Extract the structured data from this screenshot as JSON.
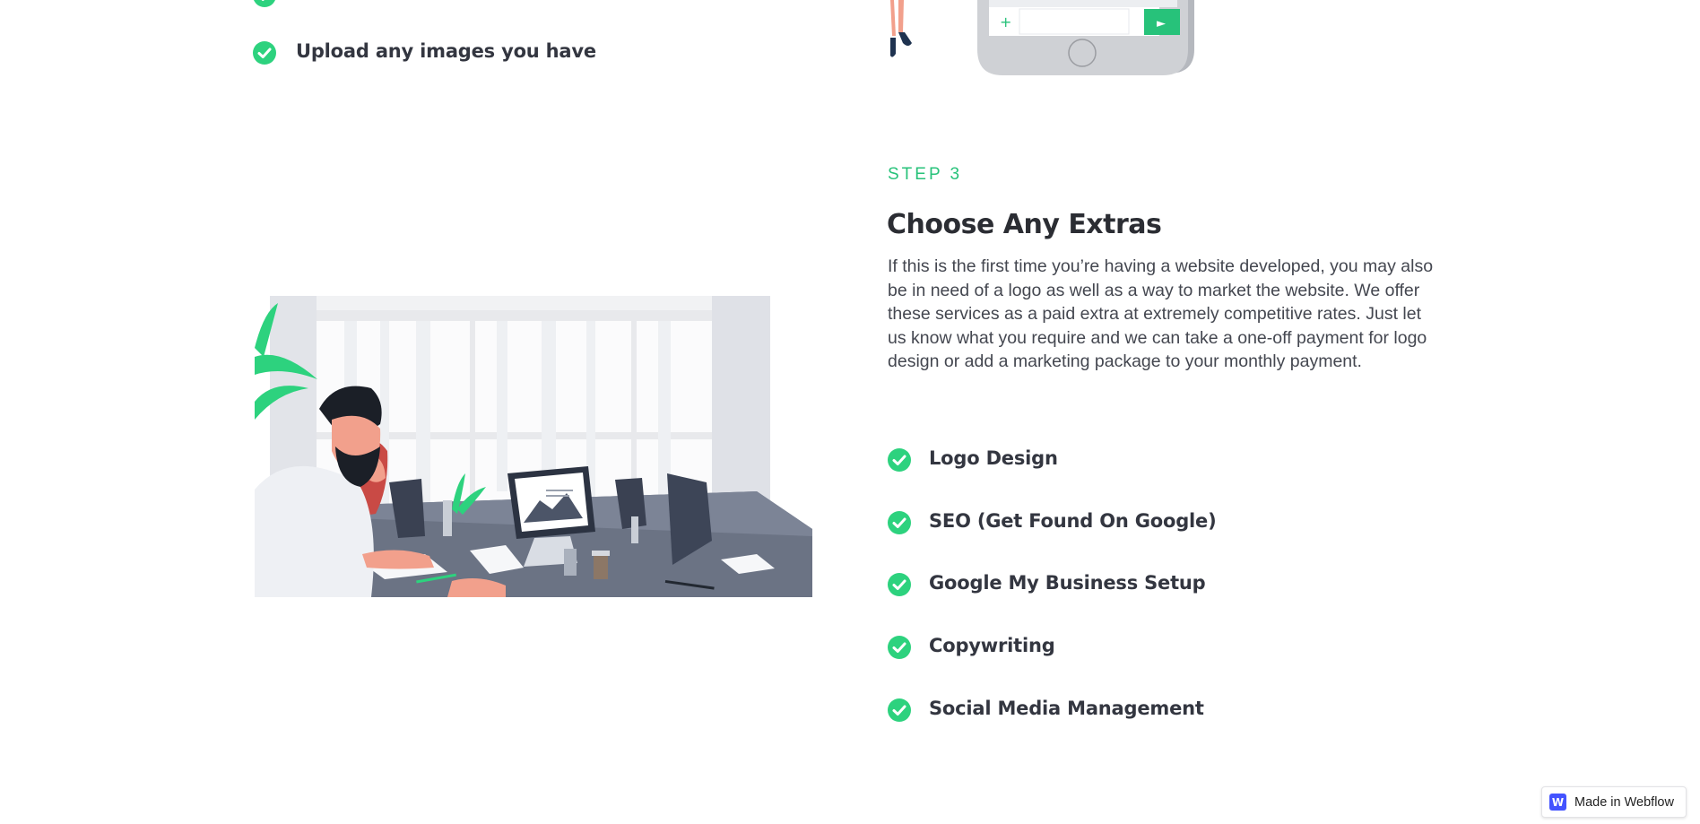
{
  "previous_step": {
    "upload_item": "Upload any images you have"
  },
  "phone_chat": {
    "plus_glyph": "+",
    "send_glyph": "►"
  },
  "step3": {
    "label": "STEP 3",
    "title": "Choose Any Extras",
    "description": "If this is the first time you’re having a website developed, you may also be in need of a logo as well as a way to market the website. We offer these services as a paid extra at extremely competitive rates. Just let us know what you require and we can take a one-off payment for logo design or add a marketing package to your monthly payment.",
    "extras": [
      "Logo Design",
      "SEO (Get Found On Google)",
      "Google My Business Setup",
      "Copywriting",
      "Social Media Management"
    ]
  },
  "badge": {
    "logo_letter": "W",
    "text": "Made in Webflow"
  },
  "colors": {
    "accent_green": "#27c27a",
    "check_green": "#2dd27e",
    "heading": "#2b2d33",
    "webflow_blue": "#4353ff"
  },
  "icons": {
    "check": "check-circle-icon",
    "webflow": "webflow-logo-icon"
  }
}
